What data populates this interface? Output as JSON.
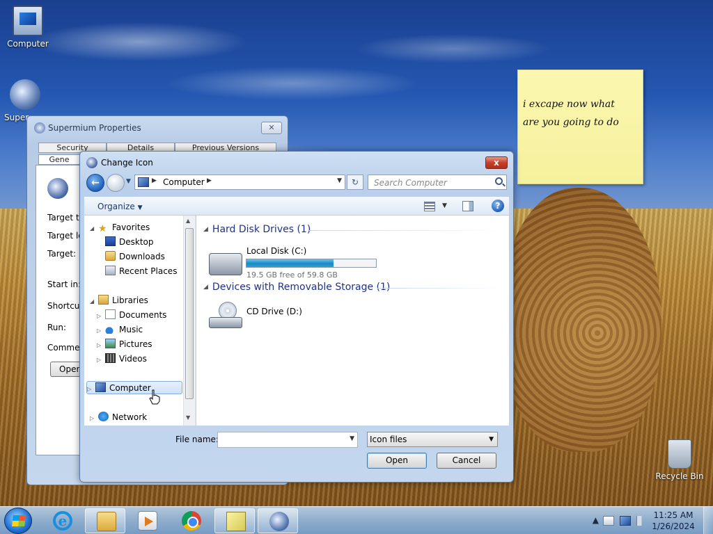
{
  "desktop": {
    "icons": [
      {
        "label": "Computer",
        "icon": "computer-icon"
      },
      {
        "label": "Super",
        "icon": "supermium-shortcut-icon"
      },
      {
        "label": "Recycle Bin",
        "icon": "recycle-bin-icon"
      }
    ],
    "sticky_note": {
      "line1": "i excape now what",
      "line2": "are you going to do"
    }
  },
  "properties_window": {
    "title": "Supermium Properties",
    "tabs_row1": [
      "Security",
      "Details",
      "Previous Versions"
    ],
    "tabs_row2": [
      "Gene"
    ],
    "labels": [
      "Target ty",
      "Target lo",
      "Target:",
      "Start in:",
      "Shortcut",
      "Run:",
      "Commen"
    ],
    "open_button": "Open"
  },
  "change_icon_dialog": {
    "title": "Change Icon",
    "close_label": "x",
    "address": {
      "crumb": "Computer"
    },
    "search": {
      "placeholder": "Search Computer"
    },
    "toolbar": {
      "organize": "Organize"
    },
    "nav_pane": {
      "favorites": "Favorites",
      "favorites_items": [
        "Desktop",
        "Downloads",
        "Recent Places"
      ],
      "libraries": "Libraries",
      "libraries_items": [
        "Documents",
        "Music",
        "Pictures",
        "Videos"
      ],
      "computer": "Computer",
      "network": "Network"
    },
    "groups": [
      {
        "header": "Hard Disk Drives (1)",
        "drive_name": "Local Disk (C:)",
        "free_text": "19.5 GB free of 59.8 GB",
        "used_fraction": 0.674
      },
      {
        "header": "Devices with Removable Storage (1)",
        "drive_name": "CD Drive (D:)"
      }
    ],
    "file_name_label": "File name:",
    "file_name_value": "",
    "file_type": "Icon files",
    "open_button": "Open",
    "cancel_button": "Cancel"
  },
  "taskbar": {
    "time": "11:25 AM",
    "date": "1/26/2024",
    "tray_arrow": "▲"
  }
}
